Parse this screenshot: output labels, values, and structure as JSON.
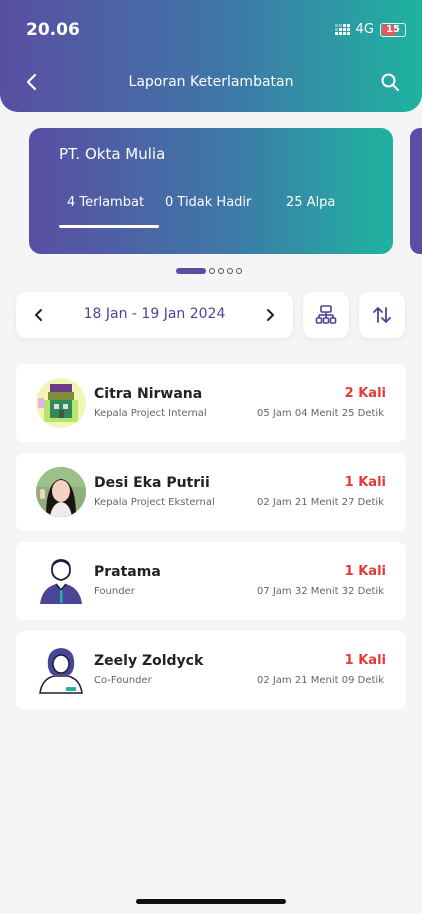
{
  "status_bar": {
    "time": "20.06",
    "network": "4G",
    "battery": "15"
  },
  "header": {
    "title": "Laporan Keterlambatan"
  },
  "summary": {
    "company": "PT. Okta Mulia",
    "stats": [
      "4 Terlambat",
      "0 Tidak Hadir",
      "25 Alpa"
    ],
    "pagination": {
      "active_page": 1,
      "total_pages": 5
    }
  },
  "filter": {
    "date_range": "18 Jan - 19 Jan 2024"
  },
  "colors": {
    "accent": "#564fa2",
    "gradient_start": "#5a4ea3",
    "gradient_end": "#1fb3a0",
    "late": "#e53935"
  },
  "employees": [
    {
      "name": "Citra Nirwana",
      "role": "Kepala Project Internal",
      "count": "2 Kali",
      "duration": "05 Jam 04 Menit 25 Detik",
      "avatar": "pixel-house-avatar"
    },
    {
      "name": "Desi Eka Putrii",
      "role": "Kepala Project Eksternal",
      "count": "1 Kali",
      "duration": "02 Jam 21 Menit 27 Detik",
      "avatar": "photo-avatar"
    },
    {
      "name": "Pratama",
      "role": "Founder",
      "count": "1 Kali",
      "duration": "07 Jam 32 Menit 32 Detik",
      "avatar": "male-illustration-avatar"
    },
    {
      "name": "Zeely Zoldyck",
      "role": "Co-Founder",
      "count": "1 Kali",
      "duration": "02 Jam 21 Menit 09 Detik",
      "avatar": "female-illustration-avatar"
    }
  ]
}
